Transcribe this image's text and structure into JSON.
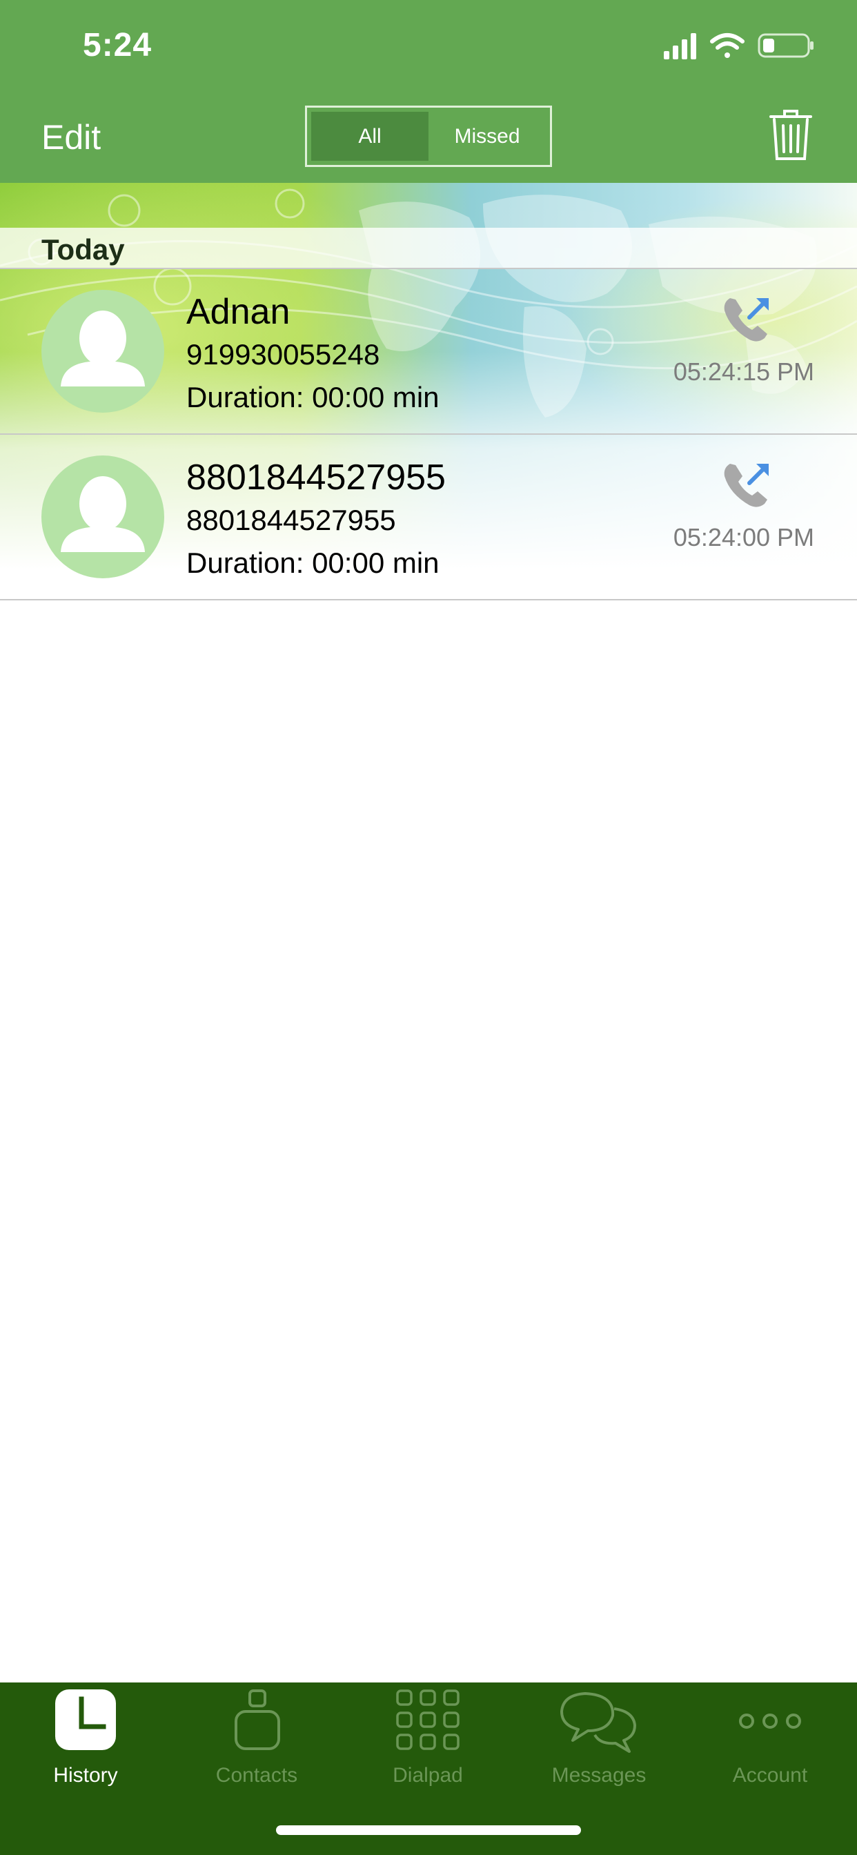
{
  "status_bar": {
    "time": "5:24"
  },
  "header": {
    "edit_label": "Edit",
    "segments": [
      {
        "label": "All",
        "active": true
      },
      {
        "label": "Missed",
        "active": false
      }
    ],
    "trash_icon": "trash-icon"
  },
  "section_title": "Today",
  "calls": [
    {
      "name": "Adnan",
      "number": "919930055248",
      "duration": "Duration: 00:00 min",
      "time": "05:24:15 PM",
      "type": "outgoing"
    },
    {
      "name": "8801844527955",
      "number": "8801844527955",
      "duration": "Duration: 00:00 min",
      "time": "05:24:00 PM",
      "type": "outgoing"
    }
  ],
  "tabs": [
    {
      "label": "History",
      "icon": "clock-icon",
      "active": true
    },
    {
      "label": "Contacts",
      "icon": "contact-icon",
      "active": false
    },
    {
      "label": "Dialpad",
      "icon": "dialpad-icon",
      "active": false
    },
    {
      "label": "Messages",
      "icon": "chat-bubbles-icon",
      "active": false
    },
    {
      "label": "Account",
      "icon": "more-dots-icon",
      "active": false
    }
  ],
  "colors": {
    "header_green": "#63a852",
    "tabbar_green": "#245a0b",
    "avatar_green": "#b5e3a6"
  }
}
